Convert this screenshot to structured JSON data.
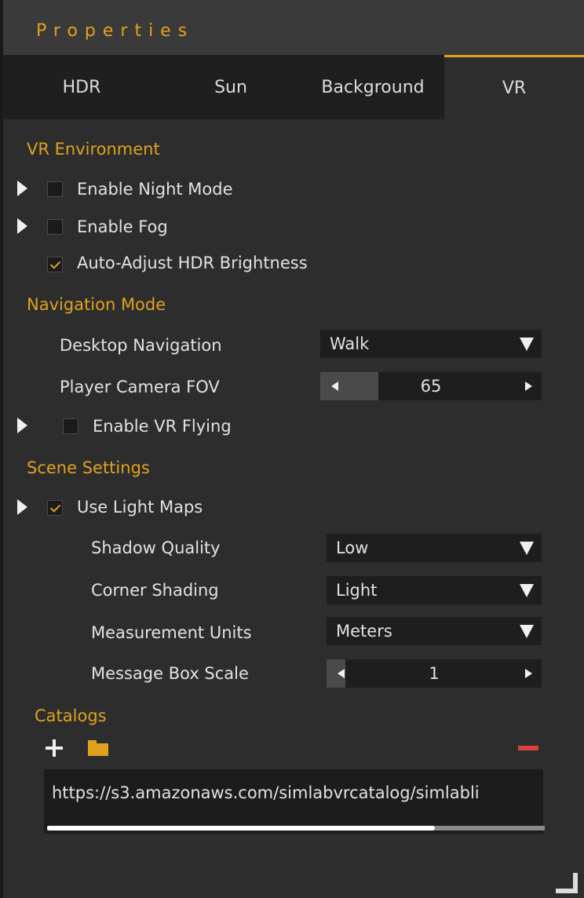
{
  "panel": {
    "title": "Properties"
  },
  "tabs": [
    {
      "label": "HDR",
      "active": false
    },
    {
      "label": "Sun",
      "active": false
    },
    {
      "label": "Background",
      "active": false
    },
    {
      "label": "VR",
      "active": true
    }
  ],
  "vr_environment": {
    "title": "VR Environment",
    "night_mode": {
      "label": "Enable Night Mode",
      "checked": false
    },
    "fog": {
      "label": "Enable Fog",
      "checked": false
    },
    "auto_adjust": {
      "label": "Auto-Adjust HDR Brightness",
      "checked": true
    }
  },
  "navigation_mode": {
    "title": "Navigation Mode",
    "desktop_navigation": {
      "label": "Desktop Navigation",
      "value": "Walk"
    },
    "camera_fov": {
      "label": "Player Camera FOV",
      "value": "65",
      "fill_fraction": 0.26
    },
    "vr_flying": {
      "label": "Enable VR Flying",
      "checked": false
    }
  },
  "scene_settings": {
    "title": "Scene Settings",
    "light_maps": {
      "label": "Use Light Maps",
      "checked": true
    },
    "shadow_quality": {
      "label": "Shadow Quality",
      "value": "Low"
    },
    "corner_shading": {
      "label": "Corner Shading",
      "value": "Light"
    },
    "measurement_units": {
      "label": "Measurement Units",
      "value": "Meters"
    },
    "message_box_scale": {
      "label": "Message Box Scale",
      "value": "1",
      "fill_fraction": 0.0
    }
  },
  "catalogs": {
    "title": "Catalogs",
    "url": "https://s3.amazonaws.com/simlabvrcatalog/simlabli",
    "scroll_fraction": 0.78
  },
  "colors": {
    "accent": "#e0a21c",
    "background": "#2d2d2d",
    "field": "#1e1e1e",
    "remove": "#d8433e"
  },
  "icons": [
    "plus-icon",
    "folder-icon",
    "minus-icon",
    "resize-icon",
    "caret-right-icon",
    "chevron-down-icon"
  ]
}
